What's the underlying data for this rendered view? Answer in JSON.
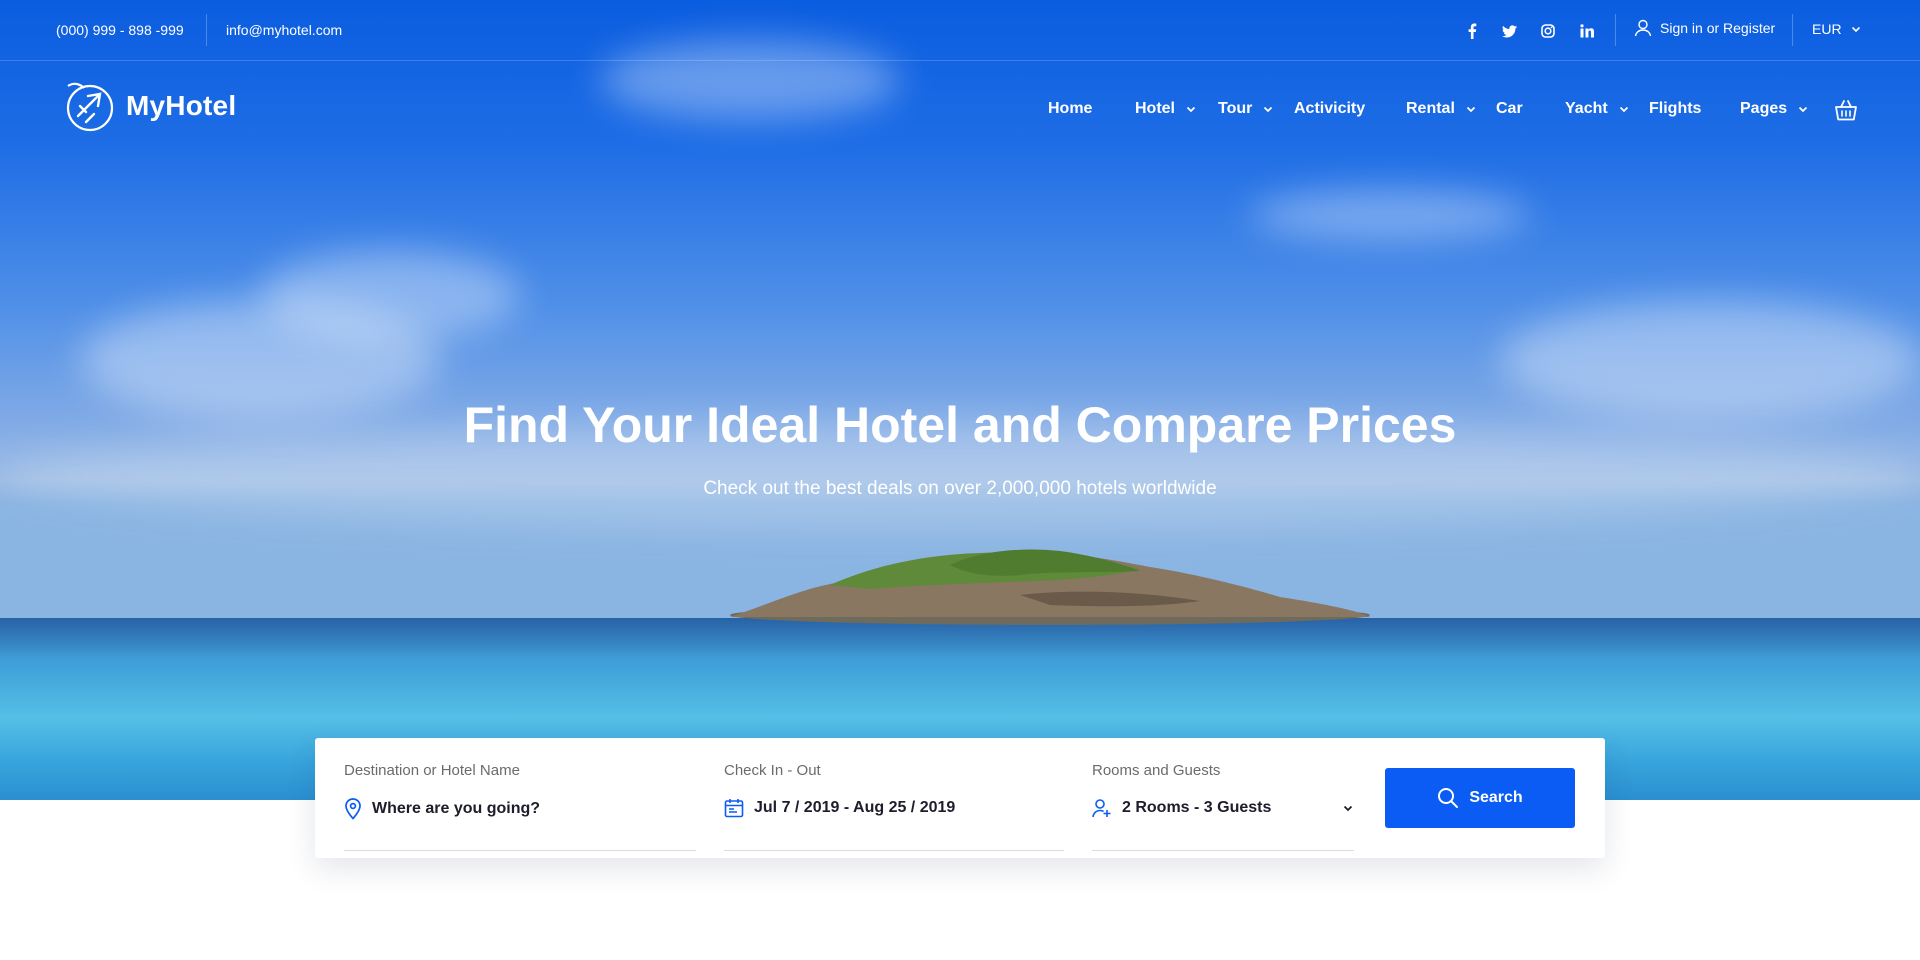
{
  "topbar": {
    "phone": "(000) 999 - 898 -999",
    "email": "info@myhotel.com",
    "signin": "Sign in or Register",
    "currency": "EUR"
  },
  "brand": {
    "name": "MyHotel"
  },
  "nav": {
    "home": "Home",
    "hotel": "Hotel",
    "tour": "Tour",
    "activity": "Activicity",
    "rental": "Rental",
    "car": "Car",
    "yacht": "Yacht",
    "flights": "Flights",
    "pages": "Pages"
  },
  "hero": {
    "title": "Find Your Ideal Hotel and Compare Prices",
    "subtitle": "Check out the best deals on over 2,000,000 hotels worldwide"
  },
  "search": {
    "destination_label": "Destination or Hotel Name",
    "destination_value": "Where are you going?",
    "dates_label": "Check In - Out",
    "dates_value": "Jul 7 / 2019 - Aug 25 / 2019",
    "guests_label": "Rooms and Guests",
    "guests_value": "2 Rooms - 3 Guests",
    "button": "Search"
  },
  "colors": {
    "accent": "#0a5cf5",
    "sky": "#0b5de0"
  }
}
